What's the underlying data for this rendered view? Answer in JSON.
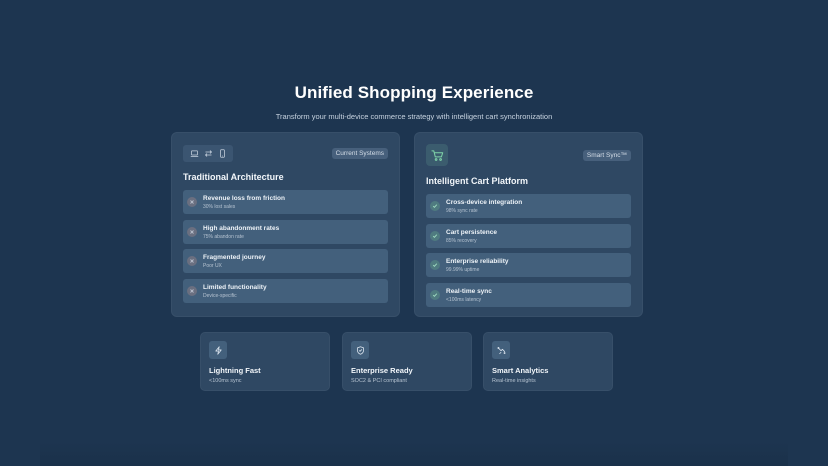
{
  "hero": {
    "title": "Unified Shopping Experience",
    "subtitle": "Transform your multi-device commerce strategy with intelligent cart synchronization"
  },
  "traditional": {
    "icons": [
      "laptop-icon",
      "swap-arrows-icon",
      "phone-icon"
    ],
    "tag": "Current Systems",
    "title": "Traditional Architecture",
    "items": [
      {
        "title": "Revenue loss from friction",
        "sub": "30% lost sales"
      },
      {
        "title": "High abandonment rates",
        "sub": "75% abandon rate"
      },
      {
        "title": "Fragmented journey",
        "sub": "Poor UX"
      },
      {
        "title": "Limited functionality",
        "sub": "Device-specific"
      }
    ]
  },
  "intelligent": {
    "icon": "cart-icon",
    "tag": "Smart Sync™",
    "title": "Intelligent Cart Platform",
    "items": [
      {
        "title": "Cross-device integration",
        "sub": "98% sync rate"
      },
      {
        "title": "Cart persistence",
        "sub": "85% recovery"
      },
      {
        "title": "Enterprise reliability",
        "sub": "99.99% uptime"
      },
      {
        "title": "Real-time sync",
        "sub": "<100ms latency"
      }
    ]
  },
  "features": [
    {
      "icon": "lightning-icon",
      "title": "Lightning Fast",
      "sub": "<100ms sync"
    },
    {
      "icon": "shield-check-icon",
      "title": "Enterprise Ready",
      "sub": "SOC2 & PCI compliant"
    },
    {
      "icon": "analytics-icon",
      "title": "Smart Analytics",
      "sub": "Real-time insights"
    }
  ],
  "colors": {
    "background": "#1d3550",
    "panel": "#2f4863",
    "item": "#43607c",
    "accent_green": "#7fd3a8",
    "problem_dot": "#6a6f80"
  }
}
